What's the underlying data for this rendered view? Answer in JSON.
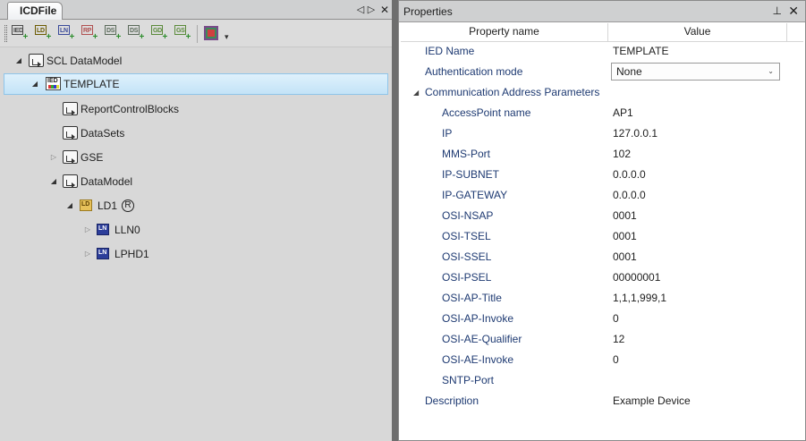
{
  "left_panel": {
    "tab_label": "ICDFile",
    "strip_buttons": [
      "◁",
      "▷",
      "✕"
    ],
    "toolbar": {
      "buttons": [
        {
          "name": "add-ied-button",
          "label": "IED",
          "color": "#4a4a4a"
        },
        {
          "name": "add-ld-button",
          "label": "LD",
          "color": "#6b5a00"
        },
        {
          "name": "add-ln-button",
          "label": "LN",
          "color": "#3a4a9a"
        },
        {
          "name": "add-rp-button",
          "label": "RP",
          "color": "#b05050"
        },
        {
          "name": "add-ds-button",
          "label": "DS",
          "color": "#5a6a5a"
        },
        {
          "name": "add-ds2-button",
          "label": "DS",
          "color": "#5a6a5a"
        },
        {
          "name": "add-gd-button",
          "label": "GD",
          "color": "#5a8a3a"
        },
        {
          "name": "add-gs-button",
          "label": "GS",
          "color": "#5a8a3a"
        }
      ],
      "overflow": "▾"
    },
    "tree": {
      "root": "SCL DataModel",
      "ied": "TEMPLATE",
      "report_control_blocks": "ReportControlBlocks",
      "datasets": "DataSets",
      "gse": "GSE",
      "datamodel": "DataModel",
      "ld": "LD1",
      "ld_badge": "R",
      "ln0": "LLN0",
      "ln1": "LPHD1",
      "icon_labels": {
        "ied": "IED",
        "ld": "LD",
        "ln": "LN"
      }
    }
  },
  "properties": {
    "title": "Properties",
    "pin": "⊥",
    "close": "✕",
    "headers": {
      "name": "Property name",
      "value": "Value"
    },
    "ied_name": {
      "label": "IED Name",
      "value": "TEMPLATE"
    },
    "auth_mode": {
      "label": "Authentication mode",
      "value": "None",
      "chevron": "⌄"
    },
    "comm_group": {
      "label": "Communication Address Parameters",
      "arrow": "◢"
    },
    "comm_params": [
      {
        "label": "AccessPoint name",
        "value": "AP1"
      },
      {
        "label": "IP",
        "value": "127.0.0.1"
      },
      {
        "label": "MMS-Port",
        "value": "102"
      },
      {
        "label": "IP-SUBNET",
        "value": "0.0.0.0"
      },
      {
        "label": "IP-GATEWAY",
        "value": "0.0.0.0"
      },
      {
        "label": "OSI-NSAP",
        "value": "0001"
      },
      {
        "label": "OSI-TSEL",
        "value": "0001"
      },
      {
        "label": "OSI-SSEL",
        "value": "0001"
      },
      {
        "label": "OSI-PSEL",
        "value": "00000001"
      },
      {
        "label": "OSI-AP-Title",
        "value": "1,1,1,999,1"
      },
      {
        "label": "OSI-AP-Invoke",
        "value": "0"
      },
      {
        "label": "OSI-AE-Qualifier",
        "value": "12"
      },
      {
        "label": "OSI-AE-Invoke",
        "value": "0"
      },
      {
        "label": "SNTP-Port",
        "value": ""
      }
    ],
    "description": {
      "label": "Description",
      "value": "Example Device"
    }
  }
}
